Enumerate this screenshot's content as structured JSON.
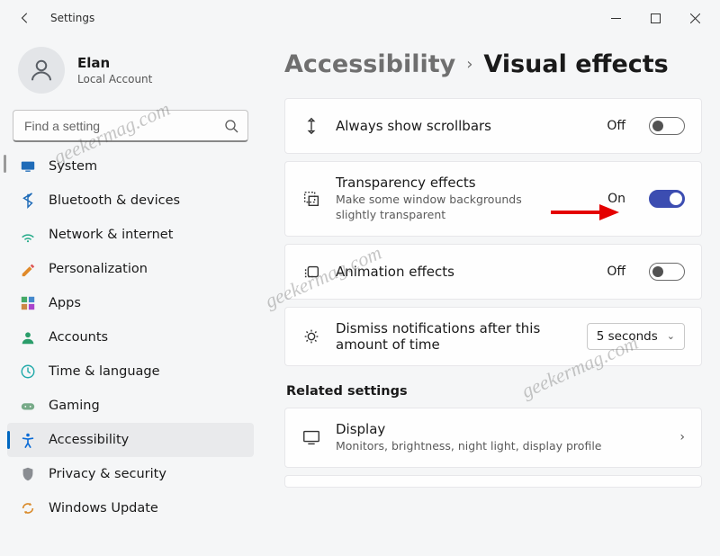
{
  "window": {
    "title": "Settings"
  },
  "profile": {
    "name": "Elan",
    "subtitle": "Local Account"
  },
  "search": {
    "placeholder": "Find a setting"
  },
  "sidebar": {
    "items": [
      {
        "label": "System"
      },
      {
        "label": "Bluetooth & devices"
      },
      {
        "label": "Network & internet"
      },
      {
        "label": "Personalization"
      },
      {
        "label": "Apps"
      },
      {
        "label": "Accounts"
      },
      {
        "label": "Time & language"
      },
      {
        "label": "Gaming"
      },
      {
        "label": "Accessibility"
      },
      {
        "label": "Privacy & security"
      },
      {
        "label": "Windows Update"
      }
    ],
    "selected_index": 8
  },
  "breadcrumb": {
    "parent": "Accessibility",
    "current": "Visual effects"
  },
  "settings": [
    {
      "icon": "scrollbar-icon",
      "title": "Always show scrollbars",
      "subtitle": "",
      "state_label": "Off",
      "toggle_on": false
    },
    {
      "icon": "transparency-icon",
      "title": "Transparency effects",
      "subtitle": "Make some window backgrounds slightly transparent",
      "state_label": "On",
      "toggle_on": true
    },
    {
      "icon": "animation-icon",
      "title": "Animation effects",
      "subtitle": "",
      "state_label": "Off",
      "toggle_on": false
    },
    {
      "icon": "notification-timer-icon",
      "title": "Dismiss notifications after this amount of time",
      "subtitle": "",
      "dropdown_value": "5 seconds"
    }
  ],
  "related": {
    "heading": "Related settings",
    "items": [
      {
        "icon": "display-icon",
        "title": "Display",
        "subtitle": "Monitors, brightness, night light, display profile"
      }
    ]
  },
  "watermark": "geekermag.com"
}
